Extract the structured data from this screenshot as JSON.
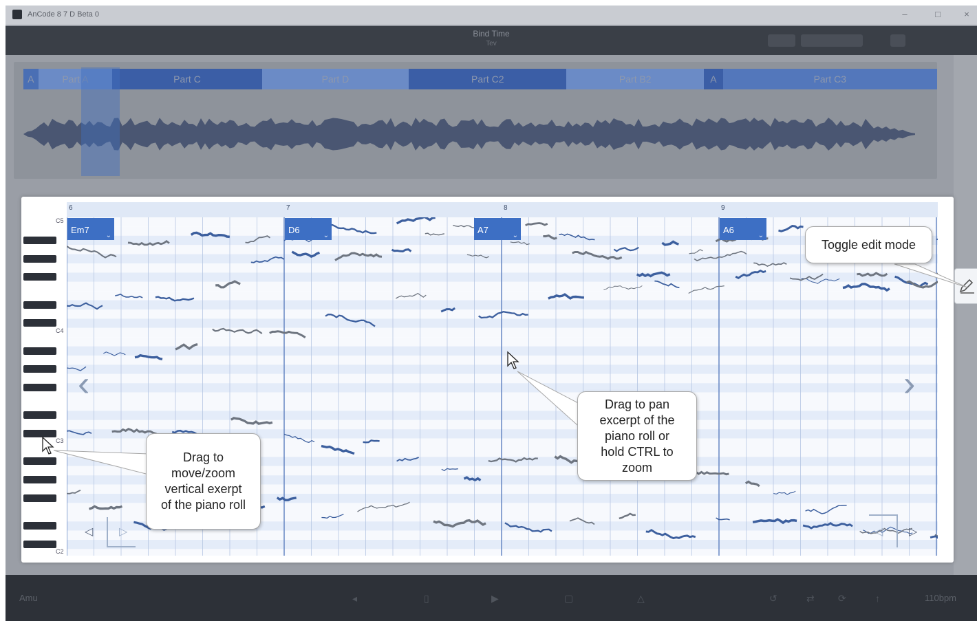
{
  "window": {
    "title": "AnCode 8 7 D Beta 0",
    "minimize_glyph": "–",
    "maximize_glyph": "□",
    "close_glyph": "×"
  },
  "song": {
    "title": "Bind Time",
    "subtitle": "Tev"
  },
  "overview": {
    "parts": [
      {
        "label": "A",
        "color": "#4a6fb4",
        "flex": 22
      },
      {
        "label": "Part A",
        "color": "#6b8bc6",
        "flex": 110
      },
      {
        "label": "Part C",
        "color": "#3b5ea6",
        "flex": 222
      },
      {
        "label": "Part D",
        "color": "#6b8bc6",
        "flex": 218
      },
      {
        "label": "Part C2",
        "color": "#3b5ea6",
        "flex": 234
      },
      {
        "label": "Part B2",
        "color": "#6b8bc6",
        "flex": 204
      },
      {
        "label": "A",
        "color": "#3b5ea6",
        "flex": 28
      },
      {
        "label": "Part C3",
        "color": "#5377bb",
        "flex": 318
      }
    ]
  },
  "piano_roll": {
    "bar_numbers": [
      "6",
      "7",
      "8",
      "9"
    ],
    "octave_labels": [
      "C5",
      "C4",
      "C3",
      "C2"
    ],
    "chords": [
      {
        "label": "Em7",
        "chevron": "⌄"
      },
      {
        "label": "D6",
        "chevron": "⌄"
      },
      {
        "label": "A7",
        "chevron": "⌄"
      },
      {
        "label": "A6",
        "chevron": "⌄"
      }
    ],
    "prev_glyph": "‹",
    "next_glyph": "›",
    "loop_start_glyph": "◁",
    "loop_end_glyph": "▷"
  },
  "callouts": {
    "toggle_edit": "Toggle edit mode",
    "drag_pan": [
      "Drag to pan",
      "excerpt of the",
      "piano roll or",
      "hold CTRL to",
      "zoom"
    ],
    "drag_zoom": [
      "Drag to",
      "move/zoom",
      "vertical exerpt",
      "of the piano roll"
    ]
  },
  "bottom_bar": {
    "left_text": "Amu",
    "right_text": "110bpm"
  },
  "colors": {
    "chord_accent": "#3d6fc4",
    "grid_stripe": "#e4ecf9",
    "pitch_trace": "#3c5f9e"
  }
}
